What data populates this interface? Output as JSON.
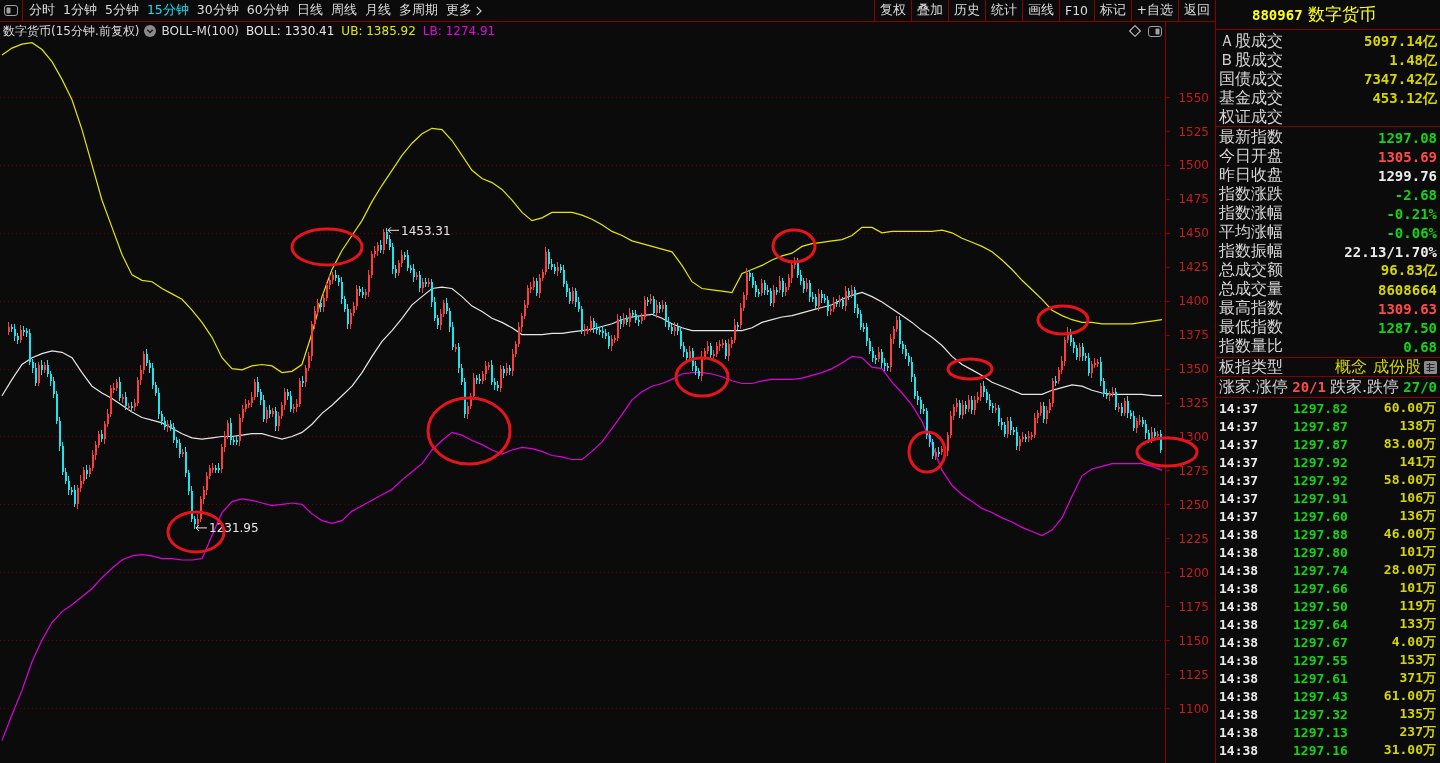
{
  "toolbar": {
    "periods": [
      {
        "label": "分时",
        "selected": false
      },
      {
        "label": "1分钟",
        "selected": false
      },
      {
        "label": "5分钟",
        "selected": false
      },
      {
        "label": "15分钟",
        "selected": true
      },
      {
        "label": "30分钟",
        "selected": false
      },
      {
        "label": "60分钟",
        "selected": false
      },
      {
        "label": "日线",
        "selected": false
      },
      {
        "label": "周线",
        "selected": false
      },
      {
        "label": "月线",
        "selected": false
      },
      {
        "label": "多周期",
        "selected": false
      }
    ],
    "more": "更多",
    "buttons": [
      "复权",
      "叠加",
      "历史",
      "统计",
      "画线",
      "F10",
      "标记",
      "+自选",
      "返回"
    ]
  },
  "chart": {
    "indicator": {
      "name": "BOLL-M(100)",
      "readings": [
        {
          "text": "BOLL: 1330.41",
          "color": "#e6e6e6"
        },
        {
          "text": "UB: 1385.92",
          "color": "#e6e600"
        },
        {
          "text": "LB: 1274.91",
          "color": "#e600e6"
        }
      ]
    },
    "chart_data": {
      "type": "line",
      "title": "数字货币(15分钟.前复权)",
      "grid": true,
      "ylim": [
        1059.5,
        1592
      ],
      "yticks": [
        1100,
        1125,
        1150,
        1175,
        1200,
        1225,
        1250,
        1275,
        1300,
        1325,
        1350,
        1375,
        1400,
        1425,
        1450,
        1475,
        1500,
        1525,
        1550
      ],
      "series": [
        {
          "color": "#e6e600",
          "values": [
            1581,
            1586,
            1589,
            1590,
            1585,
            1576,
            1563,
            1548,
            1526,
            1500,
            1474,
            1454,
            1434,
            1419,
            1415,
            1414,
            1409,
            1405,
            1401,
            1393,
            1384,
            1373,
            1358,
            1350,
            1349,
            1352,
            1353,
            1352,
            1347,
            1348,
            1353,
            1376,
            1403,
            1423,
            1437,
            1448,
            1459,
            1473,
            1485,
            1496,
            1507,
            1516,
            1523,
            1527,
            1526,
            1518,
            1507,
            1496,
            1490,
            1487,
            1482,
            1474,
            1465,
            1459,
            1461,
            1465,
            1465,
            1465,
            1463,
            1460,
            1456,
            1451,
            1448,
            1444,
            1442,
            1440,
            1438,
            1436,
            1426,
            1414,
            1409,
            1408,
            1407,
            1406,
            1420,
            1423,
            1426,
            1430,
            1433,
            1435,
            1440,
            1442,
            1443,
            1444,
            1445,
            1448,
            1454,
            1454,
            1450,
            1451,
            1451,
            1451,
            1451,
            1451,
            1452,
            1450,
            1446,
            1443,
            1440,
            1436,
            1430,
            1423,
            1415,
            1408,
            1401,
            1393,
            1389,
            1386,
            1384,
            1384,
            1383,
            1383,
            1383,
            1383,
            1384,
            1385,
            1386
          ]
        },
        {
          "color": "#e6e6e6",
          "values": [
            1330,
            1342,
            1353,
            1358,
            1361,
            1363,
            1362,
            1358,
            1347,
            1337,
            1332,
            1328,
            1323,
            1318,
            1314,
            1312,
            1310,
            1306,
            1302,
            1299,
            1298,
            1299,
            1300,
            1300,
            1301,
            1302,
            1302,
            1300,
            1298,
            1300,
            1303,
            1309,
            1317,
            1323,
            1330,
            1337,
            1347,
            1359,
            1370,
            1378,
            1387,
            1397,
            1403,
            1409,
            1410,
            1409,
            1403,
            1396,
            1392,
            1387,
            1384,
            1380,
            1375,
            1375,
            1375,
            1376,
            1376,
            1377,
            1378,
            1379,
            1381,
            1383,
            1386,
            1388,
            1389,
            1390,
            1387,
            1383,
            1380,
            1378,
            1378,
            1378,
            1378,
            1378,
            1378,
            1380,
            1384,
            1386,
            1388,
            1389,
            1391,
            1393,
            1395,
            1397,
            1401,
            1404,
            1406,
            1403,
            1399,
            1394,
            1389,
            1384,
            1378,
            1373,
            1367,
            1359,
            1353,
            1349,
            1345,
            1340,
            1337,
            1334,
            1331,
            1331,
            1331,
            1334,
            1336,
            1338,
            1337,
            1334,
            1332,
            1331,
            1331,
            1331,
            1331,
            1330,
            1330
          ]
        },
        {
          "color": "#e000e0",
          "values": [
            1076,
            1095,
            1113,
            1134,
            1150,
            1163,
            1171,
            1176,
            1182,
            1188,
            1196,
            1203,
            1209,
            1212,
            1213,
            1212,
            1210,
            1210,
            1209,
            1209,
            1210,
            1227,
            1244,
            1252,
            1254,
            1253,
            1251,
            1249,
            1250,
            1251,
            1250,
            1243,
            1238,
            1236,
            1238,
            1245,
            1249,
            1253,
            1257,
            1261,
            1268,
            1274,
            1280,
            1290,
            1297,
            1303,
            1301,
            1297,
            1294,
            1290,
            1287,
            1290,
            1292,
            1291,
            1289,
            1286,
            1285,
            1283,
            1283,
            1289,
            1296,
            1306,
            1316,
            1327,
            1333,
            1337,
            1339,
            1342,
            1346,
            1347,
            1347,
            1346,
            1344,
            1341,
            1339,
            1339,
            1341,
            1342,
            1342,
            1342,
            1343,
            1345,
            1347,
            1350,
            1354,
            1359,
            1358,
            1351,
            1350,
            1340,
            1332,
            1323,
            1311,
            1294,
            1275,
            1264,
            1257,
            1252,
            1247,
            1244,
            1240,
            1237,
            1233,
            1230,
            1227,
            1231,
            1240,
            1256,
            1271,
            1276,
            1278,
            1280,
            1280,
            1280,
            1280,
            1278,
            1275
          ]
        }
      ],
      "annotations": [
        "1453.31",
        "1231.95"
      ]
    }
  },
  "quote": {
    "code": "880967",
    "name": "数字货币"
  },
  "summary": [
    {
      "label": "Ａ股成交",
      "value": "5097.14亿"
    },
    {
      "label": "Ｂ股成交",
      "value": "1.48亿"
    },
    {
      "label": "国债成交",
      "value": "7347.42亿"
    },
    {
      "label": "基金成交",
      "value": "453.12亿"
    },
    {
      "label": "权证成交"
    }
  ],
  "stats": [
    {
      "label": "最新指数",
      "value": "1297.08",
      "color": "#14d414"
    },
    {
      "label": "今日开盘",
      "value": "1305.69",
      "color": "#ff4b4b"
    },
    {
      "label": "昨日收盘",
      "value": "1299.76",
      "color": "#ececec"
    },
    {
      "label": "指数涨跌",
      "value": "-2.68",
      "color": "#14d414"
    },
    {
      "label": "指数涨幅",
      "value": "-0.21%",
      "color": "#14d414"
    },
    {
      "label": "平均涨幅",
      "value": "-0.06%",
      "color": "#14d414"
    },
    {
      "label": "指数振幅",
      "value": "22.13/1.70%",
      "color": "#ececec"
    },
    {
      "label": "总成交额",
      "value": "96.83亿",
      "color": "#d6d600"
    },
    {
      "label": "总成交量",
      "value": "8608664",
      "color": "#d6d600"
    },
    {
      "label": "最高指数",
      "value": "1309.63",
      "color": "#ff4b4b"
    },
    {
      "label": "最低指数",
      "value": "1287.50",
      "color": "#14d414"
    },
    {
      "label": "指数量比",
      "value": "0.68",
      "color": "#14d414"
    }
  ],
  "sector_type": {
    "label": "板指类型",
    "value": "概念",
    "link": "成份股"
  },
  "breadth": {
    "up_label": "涨家.涨停",
    "up_value": "20/1",
    "down_label": "跌家.跌停",
    "down_value": "27/0"
  },
  "ticks": [
    {
      "time": "14:37",
      "price": "1297.82",
      "volume": "60.00万"
    },
    {
      "time": "14:37",
      "price": "1297.87",
      "volume": "138万"
    },
    {
      "time": "14:37",
      "price": "1297.87",
      "volume": "83.00万"
    },
    {
      "time": "14:37",
      "price": "1297.92",
      "volume": "141万"
    },
    {
      "time": "14:37",
      "price": "1297.92",
      "volume": "58.00万"
    },
    {
      "time": "14:37",
      "price": "1297.91",
      "volume": "106万"
    },
    {
      "time": "14:37",
      "price": "1297.60",
      "volume": "136万"
    },
    {
      "time": "14:38",
      "price": "1297.88",
      "volume": "46.00万"
    },
    {
      "time": "14:38",
      "price": "1297.80",
      "volume": "101万"
    },
    {
      "time": "14:38",
      "price": "1297.74",
      "volume": "28.00万"
    },
    {
      "time": "14:38",
      "price": "1297.66",
      "volume": "101万"
    },
    {
      "time": "14:38",
      "price": "1297.50",
      "volume": "119万"
    },
    {
      "time": "14:38",
      "price": "1297.64",
      "volume": "133万"
    },
    {
      "time": "14:38",
      "price": "1297.67",
      "volume": "4.00万"
    },
    {
      "time": "14:38",
      "price": "1297.55",
      "volume": "153万"
    },
    {
      "time": "14:38",
      "price": "1297.61",
      "volume": "371万"
    },
    {
      "time": "14:38",
      "price": "1297.43",
      "volume": "61.00万"
    },
    {
      "time": "14:38",
      "price": "1297.32",
      "volume": "135万"
    },
    {
      "time": "14:38",
      "price": "1297.13",
      "volume": "237万"
    },
    {
      "time": "14:38",
      "price": "1297.16",
      "volume": "31.00万"
    }
  ]
}
